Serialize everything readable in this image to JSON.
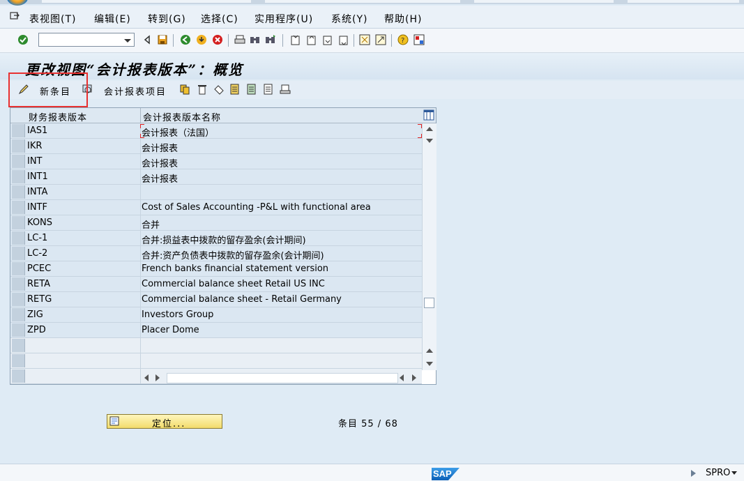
{
  "menu": {
    "items": [
      "表视图(T)",
      "编辑(E)",
      "转到(G)",
      "选择(C)",
      "实用程序(U)",
      "系统(Y)",
      "帮助(H)"
    ]
  },
  "toolbar": {
    "command_field_value": ""
  },
  "header": {
    "title": "更改视图“会计报表版本”：概览"
  },
  "app_toolbar": {
    "new_entries_label": "新条目",
    "fs_items_label": "会计报表项目"
  },
  "table": {
    "columns": [
      "财务报表版本",
      "会计报表版本名称"
    ],
    "rows": [
      {
        "version": "IAS1",
        "name": "会计报表（法国）"
      },
      {
        "version": "IKR",
        "name": "会计报表"
      },
      {
        "version": "INT",
        "name": "会计报表"
      },
      {
        "version": "INT1",
        "name": "会计报表"
      },
      {
        "version": "INTA",
        "name": ""
      },
      {
        "version": "INTF",
        "name": "Cost of Sales Accounting -P&L with functional area"
      },
      {
        "version": "KONS",
        "name": "合并"
      },
      {
        "version": "LC-1",
        "name": "合并:损益表中拨款的留存盈余(会计期间)"
      },
      {
        "version": "LC-2",
        "name": "合并:资产负债表中拨款的留存盈余(会计期间)"
      },
      {
        "version": "PCEC",
        "name": "French banks financial statement version"
      },
      {
        "version": "RETA",
        "name": "Commercial balance sheet Retail US INC"
      },
      {
        "version": "RETG",
        "name": "Commercial balance sheet - Retail Germany"
      },
      {
        "version": "ZIG",
        "name": "Investors Group"
      },
      {
        "version": "ZPD",
        "name": "Placer Dome"
      }
    ],
    "empty_rows": 3
  },
  "footer": {
    "locate_label": "定位...",
    "entry_count": "条目 55 / 68"
  },
  "status": {
    "logo": "SAP",
    "system": "SPRO"
  }
}
